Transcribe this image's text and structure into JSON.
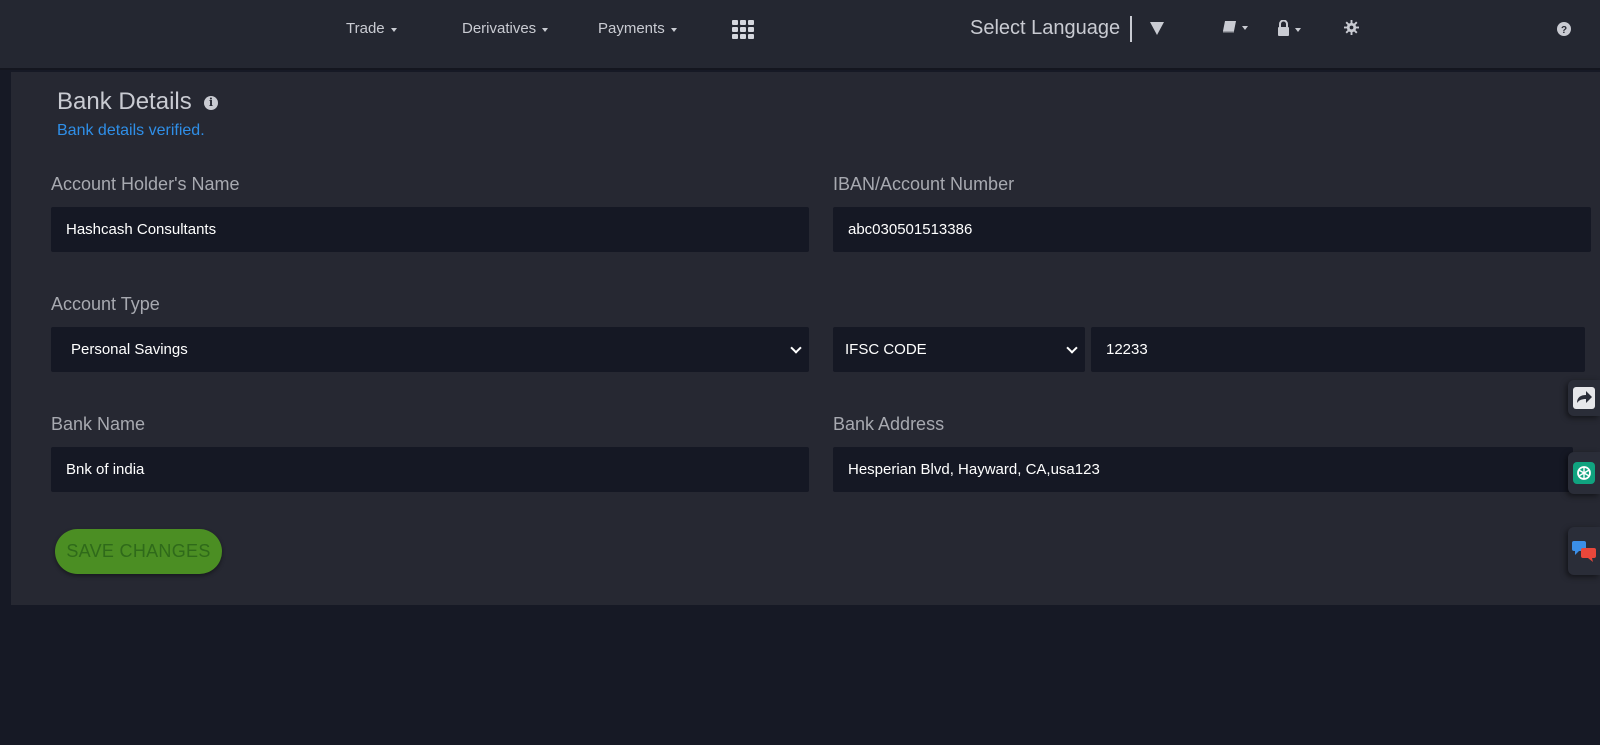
{
  "nav": {
    "items": [
      {
        "label": "Trade"
      },
      {
        "label": "Derivatives"
      },
      {
        "label": "Payments"
      }
    ],
    "language": "Select Language"
  },
  "bank": {
    "title": "Bank Details",
    "status": "Bank details verified.",
    "account_holder": {
      "label": "Account Holder's Name",
      "value": "Hashcash Consultants"
    },
    "iban": {
      "label": "IBAN/Account Number",
      "value": "abc030501513386"
    },
    "account_type": {
      "label": "Account Type",
      "value": "Personal Savings"
    },
    "code_type": {
      "value": "IFSC CODE"
    },
    "code_value": {
      "value": "12233"
    },
    "bank_name": {
      "label": "Bank Name",
      "value": "Bnk of india"
    },
    "bank_address": {
      "label": "Bank Address",
      "value": "Hesperian Blvd, Hayward, CA,usa123"
    },
    "save_label": "SAVE CHANGES"
  },
  "colors": {
    "accent_link": "#2f8fe8",
    "save_button": "#4b8e23",
    "background": "#161925",
    "panel": "#262832"
  },
  "icons": [
    "grid-icon",
    "language-dropdown-icon",
    "book-icon",
    "lock-icon",
    "gear-icon",
    "help-icon",
    "info-icon",
    "share-icon",
    "chatgpt-icon",
    "chat-icon"
  ]
}
